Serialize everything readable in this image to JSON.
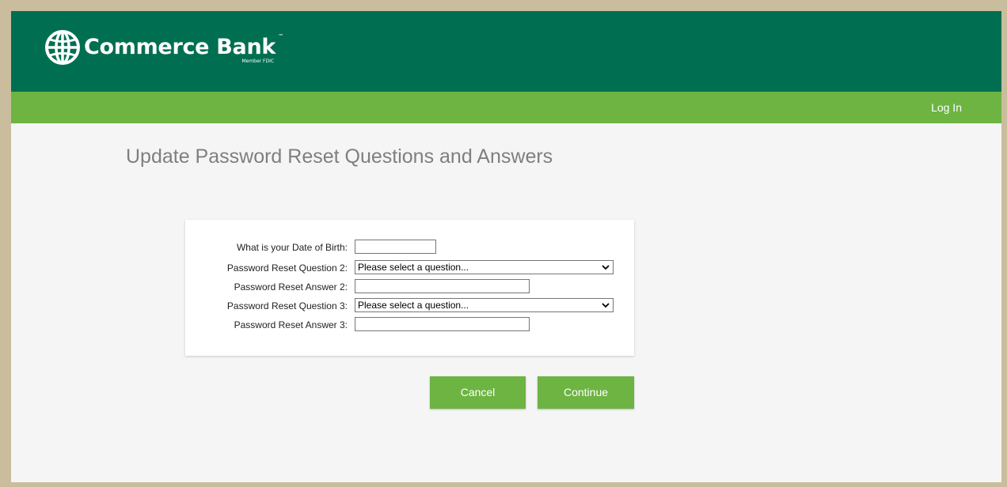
{
  "header": {
    "brand": "Commerce Bank",
    "trademark": "™",
    "member_fdic": "Member FDIC",
    "logo_icon": "globe-icon",
    "colors": {
      "top_bar": "#006f51",
      "nav_bar": "#6db443"
    }
  },
  "nav": {
    "login": "Log In"
  },
  "page": {
    "title": "Update Password Reset Questions and Answers"
  },
  "form": {
    "dob": {
      "label": "What is your Date of Birth:",
      "value": ""
    },
    "question2": {
      "label": "Password Reset Question 2:",
      "selected": "Please select a question..."
    },
    "answer2": {
      "label": "Password Reset Answer 2:",
      "value": ""
    },
    "question3": {
      "label": "Password Reset Question 3:",
      "selected": "Please select a question..."
    },
    "answer3": {
      "label": "Password Reset Answer 3:",
      "value": ""
    }
  },
  "buttons": {
    "cancel": "Cancel",
    "continue": "Continue",
    "color": "#6db443"
  }
}
